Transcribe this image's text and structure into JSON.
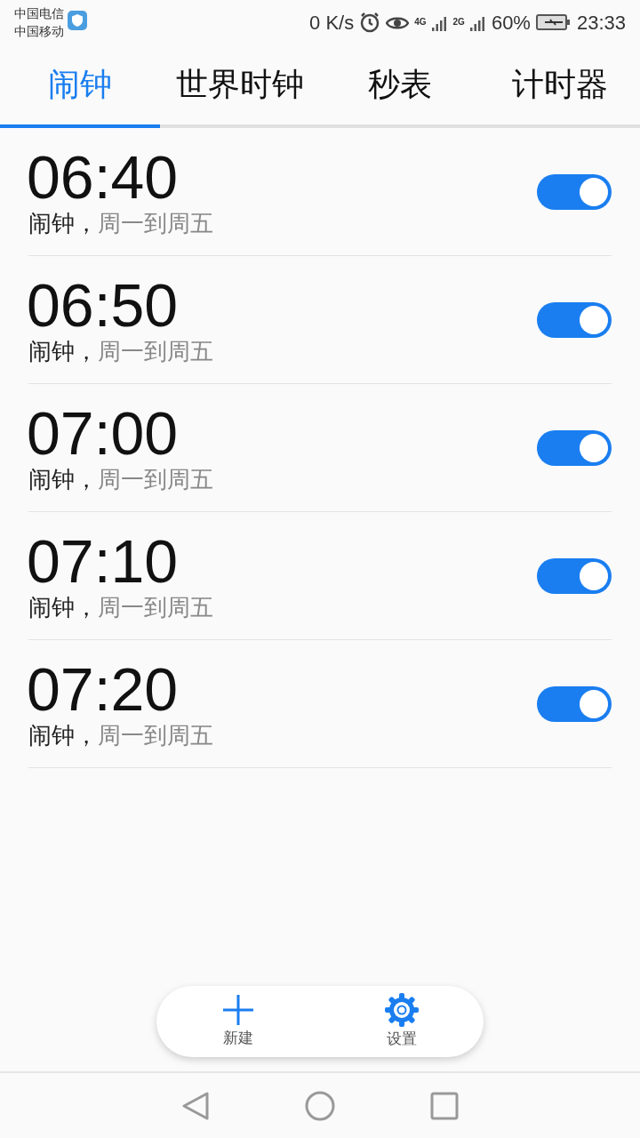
{
  "status_bar": {
    "carriers": [
      "中国电信",
      "中国移动"
    ],
    "speed": "0 K/s",
    "network_1": "4G",
    "network_2": "2G",
    "battery": "60%",
    "time": "23:33"
  },
  "tabs": [
    {
      "label": "闹钟",
      "selected": true
    },
    {
      "label": "世界时钟",
      "selected": false
    },
    {
      "label": "秒表",
      "selected": false
    },
    {
      "label": "计时器",
      "selected": false
    }
  ],
  "alarms": [
    {
      "time": "06:40",
      "label": "闹钟，",
      "repeat": "周一到周五",
      "on": true
    },
    {
      "time": "06:50",
      "label": "闹钟，",
      "repeat": "周一到周五",
      "on": true
    },
    {
      "time": "07:00",
      "label": "闹钟，",
      "repeat": "周一到周五",
      "on": true
    },
    {
      "time": "07:10",
      "label": "闹钟，",
      "repeat": "周一到周五",
      "on": true
    },
    {
      "time": "07:20",
      "label": "闹钟，",
      "repeat": "周一到周五",
      "on": true
    }
  ],
  "actions": [
    {
      "kind": "add",
      "label": "新建"
    },
    {
      "kind": "settings",
      "label": "设置"
    }
  ]
}
